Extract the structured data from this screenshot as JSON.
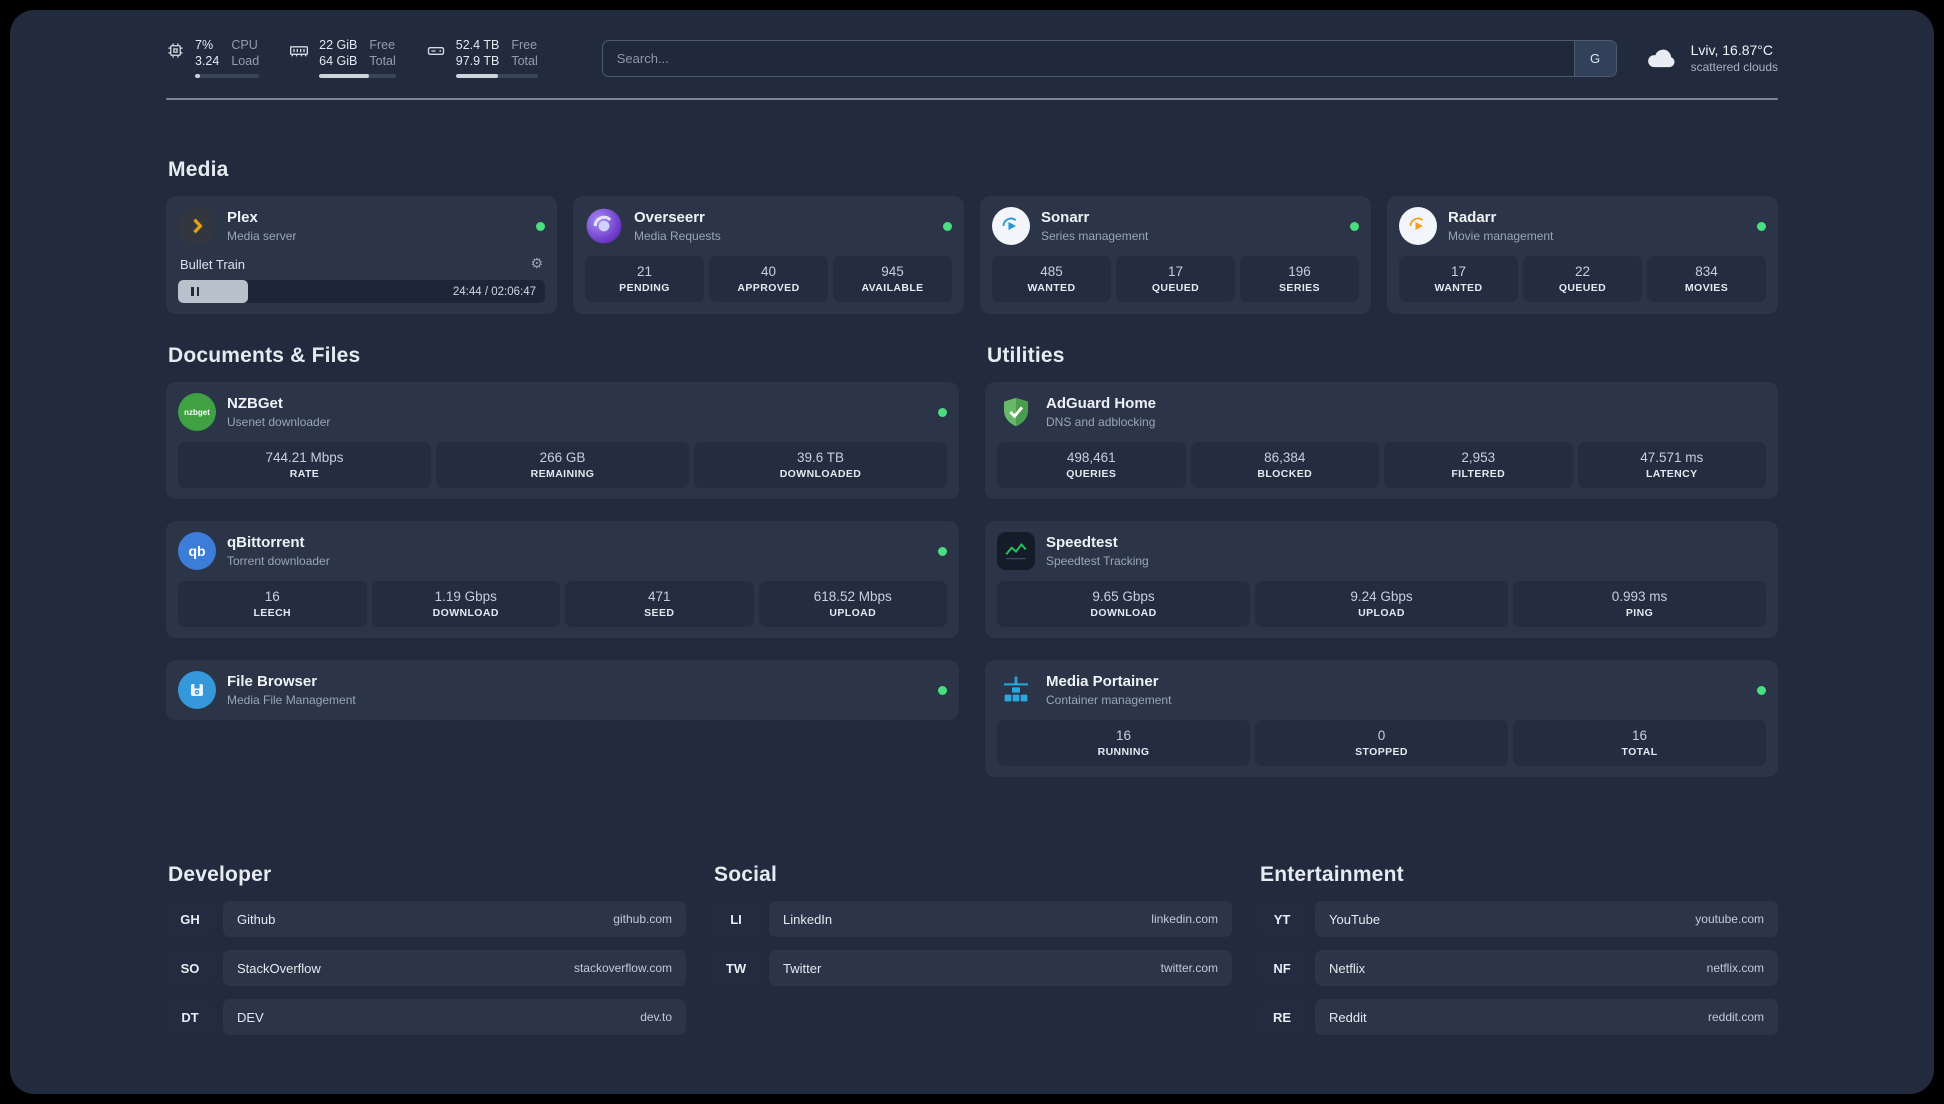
{
  "topbar": {
    "cpu": {
      "value_top": "7%",
      "value_bottom": "3.24",
      "label_top": "CPU",
      "label_bottom": "Load",
      "fill_percent": 8
    },
    "ram": {
      "value_top": "22 GiB",
      "value_bottom": "64 GiB",
      "label_top": "Free",
      "label_bottom": "Total",
      "fill_percent": 65
    },
    "disk": {
      "value_top": "52.4 TB",
      "value_bottom": "97.9 TB",
      "label_top": "Free",
      "label_bottom": "Total",
      "fill_percent": 52
    },
    "search": {
      "placeholder": "Search...",
      "button_label": "G"
    },
    "weather": {
      "location": "Lviv, 16.87°C",
      "condition": "scattered clouds"
    }
  },
  "sections": {
    "media": {
      "title": "Media",
      "plex": {
        "name": "Plex",
        "description": "Media server",
        "now_playing": {
          "title": "Bullet Train",
          "time": "24:44 / 02:06:47",
          "progress_percent": 19
        }
      },
      "overseerr": {
        "name": "Overseerr",
        "description": "Media Requests",
        "stats": [
          {
            "value": "21",
            "label": "PENDING"
          },
          {
            "value": "40",
            "label": "APPROVED"
          },
          {
            "value": "945",
            "label": "AVAILABLE"
          }
        ]
      },
      "sonarr": {
        "name": "Sonarr",
        "description": "Series management",
        "stats": [
          {
            "value": "485",
            "label": "WANTED"
          },
          {
            "value": "17",
            "label": "QUEUED"
          },
          {
            "value": "196",
            "label": "SERIES"
          }
        ]
      },
      "radarr": {
        "name": "Radarr",
        "description": "Movie management",
        "stats": [
          {
            "value": "17",
            "label": "WANTED"
          },
          {
            "value": "22",
            "label": "QUEUED"
          },
          {
            "value": "834",
            "label": "MOVIES"
          }
        ]
      }
    },
    "documents": {
      "title": "Documents & Files",
      "nzbget": {
        "name": "NZBGet",
        "description": "Usenet downloader",
        "icon_text": "nzbget",
        "stats": [
          {
            "value": "744.21 Mbps",
            "label": "RATE"
          },
          {
            "value": "266 GB",
            "label": "REMAINING"
          },
          {
            "value": "39.6 TB",
            "label": "DOWNLOADED"
          }
        ]
      },
      "qbittorrent": {
        "name": "qBittorrent",
        "description": "Torrent downloader",
        "icon_text": "qb",
        "stats": [
          {
            "value": "16",
            "label": "LEECH"
          },
          {
            "value": "1.19 Gbps",
            "label": "DOWNLOAD"
          },
          {
            "value": "471",
            "label": "SEED"
          },
          {
            "value": "618.52 Mbps",
            "label": "UPLOAD"
          }
        ]
      },
      "filebrowser": {
        "name": "File Browser",
        "description": "Media File Management"
      }
    },
    "utilities": {
      "title": "Utilities",
      "adguard": {
        "name": "AdGuard Home",
        "description": "DNS and adblocking",
        "stats": [
          {
            "value": "498,461",
            "label": "QUERIES"
          },
          {
            "value": "86,384",
            "label": "BLOCKED"
          },
          {
            "value": "2,953",
            "label": "FILTERED"
          },
          {
            "value": "47.571 ms",
            "label": "LATENCY"
          }
        ]
      },
      "speedtest": {
        "name": "Speedtest",
        "description": "Speedtest Tracking",
        "stats": [
          {
            "value": "9.65 Gbps",
            "label": "DOWNLOAD"
          },
          {
            "value": "9.24 Gbps",
            "label": "UPLOAD"
          },
          {
            "value": "0.993 ms",
            "label": "PING"
          }
        ]
      },
      "portainer": {
        "name": "Media Portainer",
        "description": "Container management",
        "stats": [
          {
            "value": "16",
            "label": "RUNNING"
          },
          {
            "value": "0",
            "label": "STOPPED"
          },
          {
            "value": "16",
            "label": "TOTAL"
          }
        ]
      }
    },
    "bookmarks": [
      {
        "title": "Developer",
        "items": [
          {
            "abbr": "GH",
            "name": "Github",
            "url": "github.com"
          },
          {
            "abbr": "SO",
            "name": "StackOverflow",
            "url": "stackoverflow.com"
          },
          {
            "abbr": "DT",
            "name": "DEV",
            "url": "dev.to"
          }
        ]
      },
      {
        "title": "Social",
        "items": [
          {
            "abbr": "LI",
            "name": "LinkedIn",
            "url": "linkedin.com"
          },
          {
            "abbr": "TW",
            "name": "Twitter",
            "url": "twitter.com"
          }
        ]
      },
      {
        "title": "Entertainment",
        "items": [
          {
            "abbr": "YT",
            "name": "YouTube",
            "url": "youtube.com"
          },
          {
            "abbr": "NF",
            "name": "Netflix",
            "url": "netflix.com"
          },
          {
            "abbr": "RE",
            "name": "Reddit",
            "url": "reddit.com"
          }
        ]
      }
    ]
  },
  "colors": {
    "status_online": "#4ade80",
    "plex_accent": "#e5a00d",
    "background": "#212b3d",
    "card": "#2b3547"
  }
}
